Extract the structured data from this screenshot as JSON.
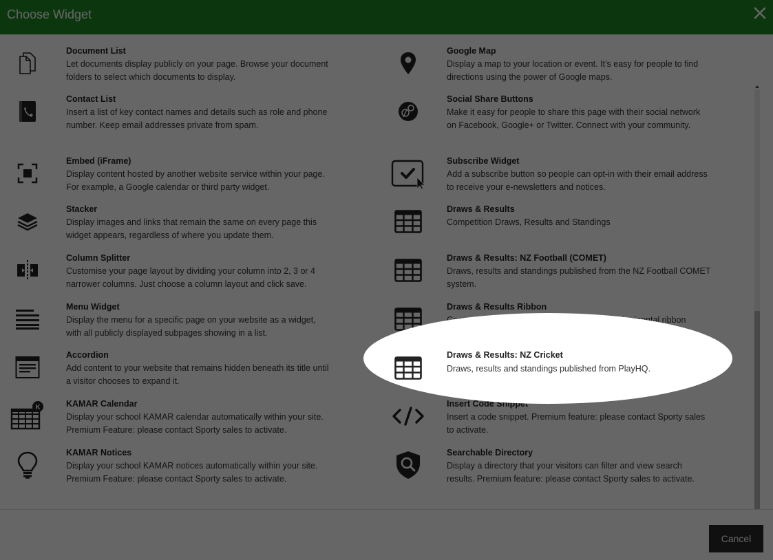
{
  "dialog": {
    "title": "Choose Widget",
    "cancel_label": "Cancel"
  },
  "widgets_left": [
    {
      "name": "Document List",
      "description": "Let documents display publicly on your page. Browse your document folders to select which documents to display.",
      "icon": "document-icon"
    },
    {
      "name": "Contact List",
      "description": "Insert a list of key contact names and details such as role and phone number. Keep email addresses private from spam.",
      "icon": "phone-book-icon"
    },
    {
      "name": "Embed (iFrame)",
      "description": "Display content hosted by another website service within your page. For example, a Google calendar or third party widget.",
      "icon": "embed-frame-icon"
    },
    {
      "name": "Stacker",
      "description": "Display images and links that remain the same on every page this widget appears, regardless of where you update them.",
      "icon": "layers-icon"
    },
    {
      "name": "Column Splitter",
      "description": "Customise your page layout by dividing your column into 2, 3 or 4 narrower columns. Just choose a column layout and click save.",
      "icon": "column-split-icon"
    },
    {
      "name": "Menu Widget",
      "description": "Display the menu for a specific page on your website as a widget, with all publicly displayed subpages showing in a list.",
      "icon": "menu-lines-icon"
    },
    {
      "name": "Accordion",
      "description": "Add content to your website that remains hidden beneath its title until a visitor chooses to expand it.",
      "icon": "accordion-icon"
    },
    {
      "name": "KAMAR Calendar",
      "description": "Display your school KAMAR calendar automatically within your site. Premium Feature: please contact Sporty sales to activate.",
      "icon": "kamar-calendar-icon"
    },
    {
      "name": "KAMAR Notices",
      "description": "Display your school KAMAR notices automatically within your site. Premium Feature: please contact Sporty sales to activate.",
      "icon": "lightbulb-icon"
    }
  ],
  "widgets_right": [
    {
      "name": "Google Map",
      "description": "Display a map to your location or event. It’s easy for people to find directions using the power of Google maps.",
      "icon": "map-pin-icon"
    },
    {
      "name": "Social Share Buttons",
      "description": "Make it easy for people to share this page with their social network on Facebook, Google+ or Twitter. Connect with your community.",
      "icon": "social-share-icon"
    },
    {
      "name": "Subscribe Widget",
      "description": "Add a subscribe button so people can opt-in with their email address to receive your e-newsletters and notices.",
      "icon": "subscribe-check-icon"
    },
    {
      "name": "Draws & Results",
      "description": "Competition Draws, Results and Standings",
      "icon": "grid-table-icon"
    },
    {
      "name": "Draws & Results: NZ Football (COMET)",
      "description": "Draws, results and standings published from the NZ Football COMET system.",
      "icon": "grid-table-icon"
    },
    {
      "name": "Draws & Results Ribbon",
      "description": "Competition draws and results displayed as a horizontal ribbon",
      "icon": "grid-table-icon"
    },
    {
      "name": "Draws & Results: NZ Cricket",
      "description": "Draws, results and standings published from PlayHQ.",
      "icon": "grid-table-icon"
    },
    {
      "name": "Insert Code Snippet",
      "description": "Insert a code snippet. Premium feature: please contact Sporty sales to activate.",
      "icon": "code-icon"
    },
    {
      "name": "Searchable Directory",
      "description": "Display a directory that your visitors can filter and view search results. Premium feature: please contact Sporty sales to activate.",
      "icon": "shield-search-icon"
    }
  ],
  "colors": {
    "header_bg": "#1f8a24",
    "overlay": "rgba(0,0,0,0.6)",
    "cancel_bg": "#2a2a2a"
  }
}
